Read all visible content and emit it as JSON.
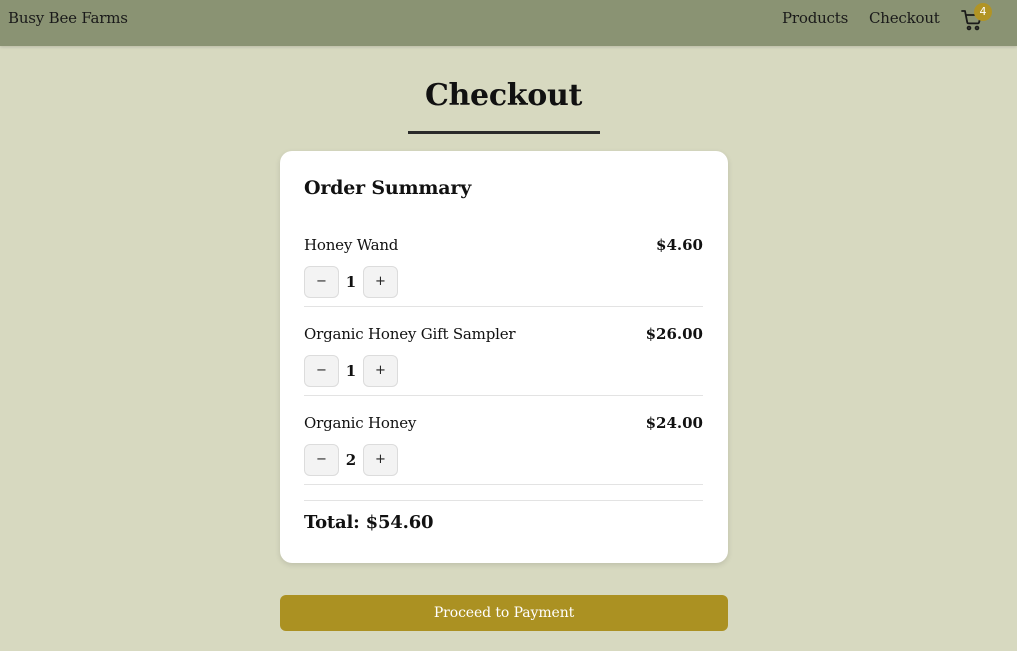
{
  "header": {
    "brand": "Busy Bee Farms",
    "nav": {
      "products_label": "Products",
      "checkout_label": "Checkout"
    },
    "cart": {
      "icon": "shopping-cart-icon",
      "count": "4"
    }
  },
  "page": {
    "title": "Checkout"
  },
  "summary": {
    "title": "Order Summary",
    "items": [
      {
        "name": "Honey Wand",
        "price": "$4.60",
        "quantity": "1",
        "decrement_label": "−",
        "increment_label": "+"
      },
      {
        "name": "Organic Honey Gift Sampler",
        "price": "$26.00",
        "quantity": "1",
        "decrement_label": "−",
        "increment_label": "+"
      },
      {
        "name": "Organic Honey",
        "price": "$24.00",
        "quantity": "2",
        "decrement_label": "−",
        "increment_label": "+"
      }
    ],
    "total_label": "Total: $54.60"
  },
  "actions": {
    "proceed_label": "Proceed to Payment"
  },
  "colors": {
    "background": "#d7d9c0",
    "navbar": "#8a9373",
    "accent": "#ab9122",
    "card": "#ffffff"
  }
}
